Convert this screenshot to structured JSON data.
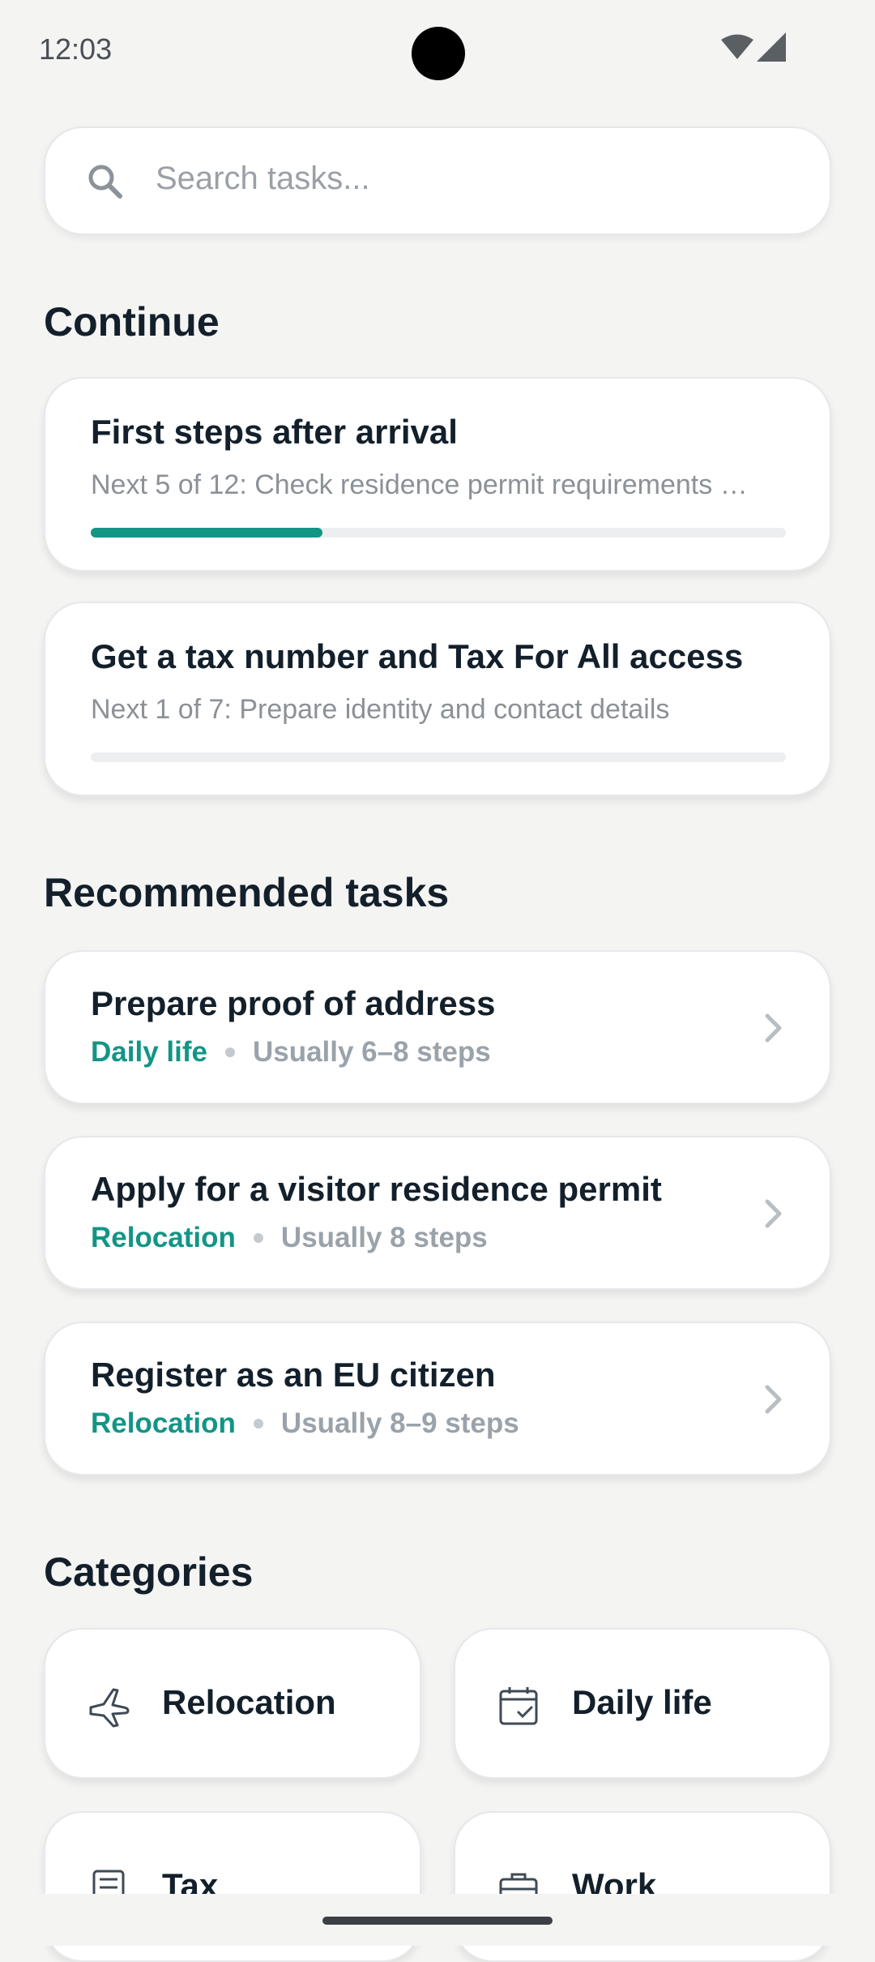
{
  "status": {
    "time": "12:03"
  },
  "search": {
    "placeholder": "Search tasks..."
  },
  "continue": {
    "title": "Continue",
    "items": [
      {
        "title": "First steps after arrival",
        "subtitle": "Next 5 of 12: Check residence permit requirements …",
        "progress": 0.333
      },
      {
        "title": "Get a tax number and Tax For All access",
        "subtitle": "Next 1 of 7: Prepare identity and contact details",
        "progress": 0
      }
    ]
  },
  "recommended": {
    "title": "Recommended tasks",
    "items": [
      {
        "title": "Prepare proof of address",
        "category": "Daily life",
        "steps": "Usually 6–8 steps"
      },
      {
        "title": "Apply for a visitor residence permit",
        "category": "Relocation",
        "steps": "Usually 8 steps"
      },
      {
        "title": "Register as an EU citizen",
        "category": "Relocation",
        "steps": "Usually 8–9 steps"
      }
    ]
  },
  "categories": {
    "title": "Categories",
    "items": [
      {
        "label": "Relocation",
        "icon": "airplane-icon"
      },
      {
        "label": "Daily life",
        "icon": "calendar-check-icon"
      },
      {
        "label": "Tax",
        "icon": "document-icon"
      },
      {
        "label": "Work",
        "icon": "briefcase-icon"
      }
    ]
  },
  "colors": {
    "accent": "#129585",
    "background": "#f4f4f3"
  }
}
